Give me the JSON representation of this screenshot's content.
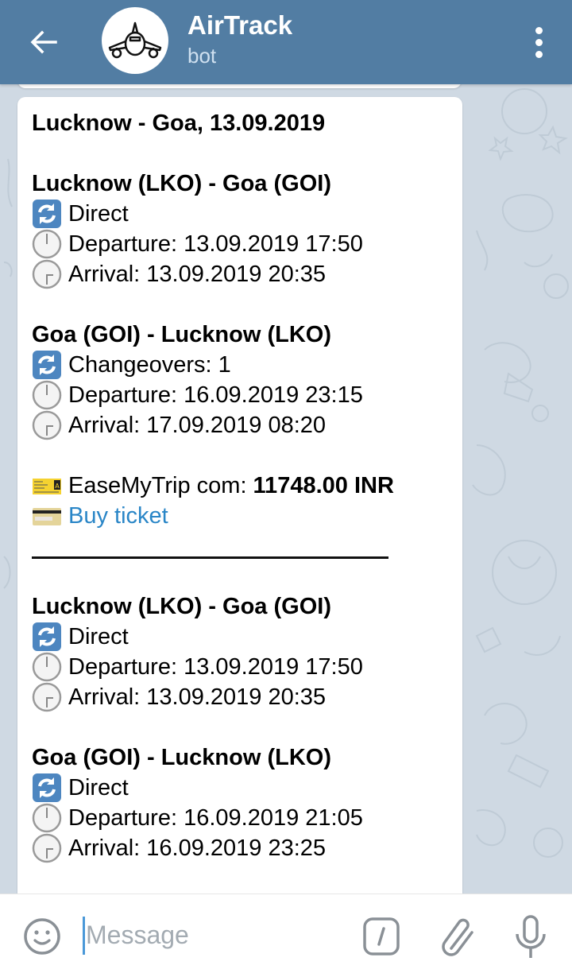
{
  "header": {
    "title": "AirTrack",
    "subtitle": "bot",
    "back_icon": "arrow-left-icon",
    "avatar_icon": "airplane-icon",
    "menu_icon": "more-vertical-icon"
  },
  "message": {
    "title": "Lucknow - Goa, 13.09.2019",
    "offers": [
      {
        "legs": [
          {
            "route": "Lucknow (LKO) - Goa (GOI)",
            "stops": "Direct",
            "departure": "Departure: 13.09.2019 17:50",
            "arrival": "Arrival: 13.09.2019 20:35"
          },
          {
            "route": "Goa (GOI) - Lucknow (LKO)",
            "stops": "Changeovers: 1",
            "departure": "Departure: 16.09.2019 23:15",
            "arrival": "Arrival: 17.09.2019 08:20"
          }
        ],
        "agency": "EaseMyTrip com: ",
        "price": "11748.00 INR",
        "buy_label": "Buy ticket",
        "divider": "________________________________"
      },
      {
        "legs": [
          {
            "route": "Lucknow (LKO) - Goa (GOI)",
            "stops": "Direct",
            "departure": "Departure: 13.09.2019 17:50",
            "arrival": "Arrival: 13.09.2019 20:35"
          },
          {
            "route": "Goa (GOI) - Lucknow (LKO)",
            "stops": "Direct",
            "departure": "Departure: 16.09.2019 21:05",
            "arrival": "Arrival: 16.09.2019 23:25"
          }
        ]
      }
    ]
  },
  "input": {
    "placeholder": "Message",
    "value": ""
  },
  "icons": {
    "stops": "arrows-counterclockwise-icon",
    "departure": "clock-one-icon",
    "arrival": "clock-three-icon",
    "agency": "ticket-icon",
    "buy": "credit-card-icon",
    "emoji": "smiley-icon",
    "command": "slash-command-icon",
    "attach": "paperclip-icon",
    "mic": "microphone-icon"
  },
  "colors": {
    "header": "#527da3",
    "link": "#2a86c7",
    "chat_bg": "#cfd9e3"
  }
}
